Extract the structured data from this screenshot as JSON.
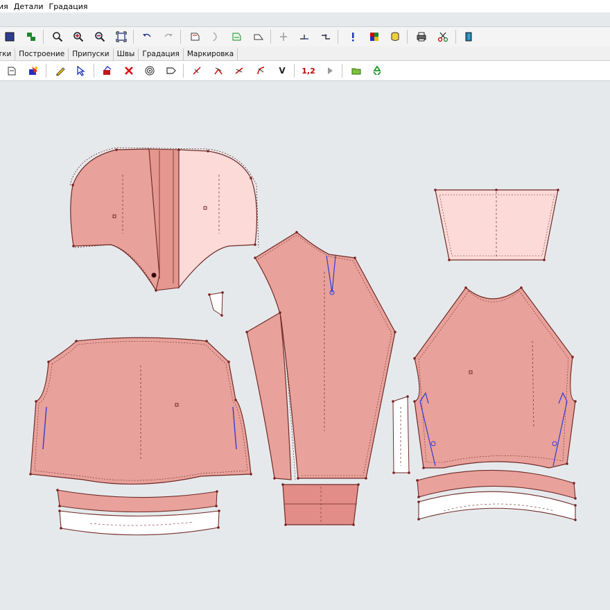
{
  "menu": [
    "ия",
    "Детали",
    "Градация"
  ],
  "tabs": [
    "тки",
    "Построение",
    "Припуски",
    "Швы",
    "Градация",
    "Маркировка"
  ],
  "toolbar2": {
    "value_label": "1,2",
    "v_label": "V"
  },
  "colors": {
    "piece_fill": "#e8a29b",
    "piece_light": "#fbdad8",
    "piece_white": "#ffffff",
    "outline": "#6e2a26",
    "point": "#7a2020",
    "accent_blue": "#2f3bd6",
    "canvas_bg": "#e6e9ec"
  }
}
